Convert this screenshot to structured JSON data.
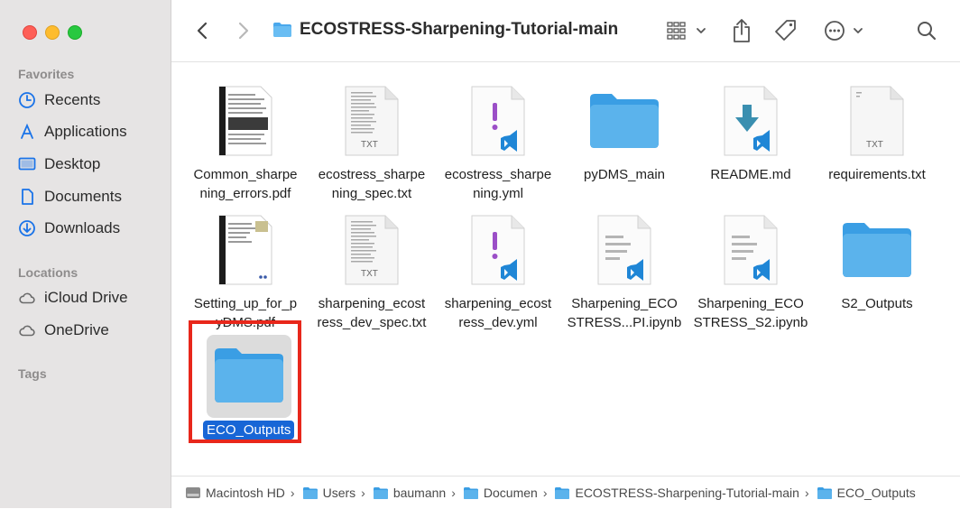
{
  "window": {
    "title": "ECOSTRESS-Sharpening-Tutorial-main"
  },
  "sidebar": {
    "favorites_heading": "Favorites",
    "favorites": [
      {
        "label": "Recents",
        "icon": "clock-icon"
      },
      {
        "label": "Applications",
        "icon": "applications-icon"
      },
      {
        "label": "Desktop",
        "icon": "desktop-icon"
      },
      {
        "label": "Documents",
        "icon": "document-icon"
      },
      {
        "label": "Downloads",
        "icon": "download-icon"
      }
    ],
    "locations_heading": "Locations",
    "locations": [
      {
        "label": "iCloud Drive",
        "icon": "cloud-icon"
      },
      {
        "label": "OneDrive",
        "icon": "cloud-icon"
      }
    ],
    "tags_heading": "Tags"
  },
  "files": [
    {
      "name": "Common_sharpe\nning_errors.pdf",
      "kind": "pdf"
    },
    {
      "name": "ecostress_sharpe\nning_spec.txt",
      "kind": "txt-thumb",
      "badge": "TXT"
    },
    {
      "name": "ecostress_sharpe\nning.yml",
      "kind": "yml"
    },
    {
      "name": "pyDMS_main",
      "kind": "folder"
    },
    {
      "name": "README.md",
      "kind": "md"
    },
    {
      "name": "requirements.txt",
      "kind": "txt",
      "badge": "TXT"
    },
    {
      "name": "Setting_up_for_p\nyDMS.pdf",
      "kind": "pdf2"
    },
    {
      "name": "sharpening_ecost\nress_dev_spec.txt",
      "kind": "txt-thumb",
      "badge": "TXT"
    },
    {
      "name": "sharpening_ecost\nress_dev.yml",
      "kind": "yml"
    },
    {
      "name": "Sharpening_ECO\nSTRESS...PI.ipynb",
      "kind": "ipynb"
    },
    {
      "name": "Sharpening_ECO\nSTRESS_S2.ipynb",
      "kind": "ipynb"
    },
    {
      "name": "S2_Outputs",
      "kind": "folder"
    },
    {
      "name": "ECO_Outputs",
      "kind": "folder",
      "selected": true
    }
  ],
  "pathbar": [
    {
      "label": "Macintosh HD",
      "icon": "hard-drive-icon"
    },
    {
      "label": "Users",
      "icon": "folder-icon"
    },
    {
      "label": "baumann",
      "icon": "folder-icon"
    },
    {
      "label": "Documen",
      "icon": "folder-icon"
    },
    {
      "label": "ECOSTRESS-Sharpening-Tutorial-main",
      "icon": "folder-icon"
    },
    {
      "label": "ECO_Outputs",
      "icon": "folder-icon"
    }
  ],
  "colors": {
    "accent": "#1866d6",
    "folder": "#5bb3ec",
    "highlight": "#e8271b"
  }
}
